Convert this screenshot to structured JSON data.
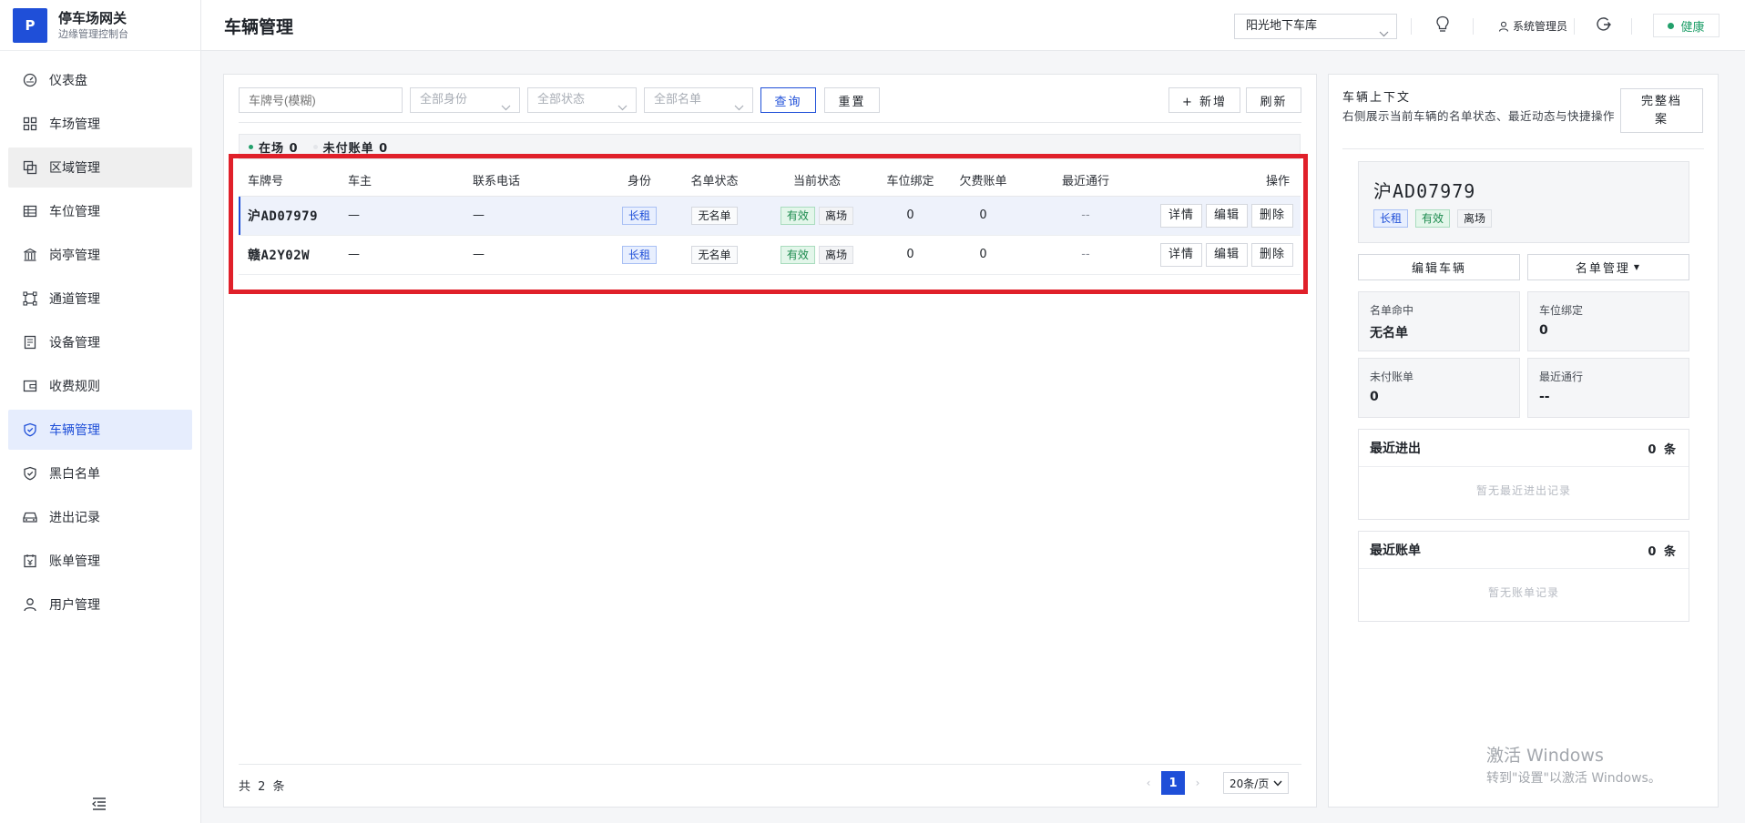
{
  "brand": {
    "logo": "P",
    "title": "停车场网关",
    "subtitle": "边缘管理控制台"
  },
  "sidebar": {
    "items": [
      {
        "label": "仪表盘",
        "icon": "dashboard-icon"
      },
      {
        "label": "车场管理",
        "icon": "grid-icon"
      },
      {
        "label": "区域管理",
        "icon": "layers-icon"
      },
      {
        "label": "车位管理",
        "icon": "table-icon"
      },
      {
        "label": "岗亭管理",
        "icon": "booth-icon"
      },
      {
        "label": "通道管理",
        "icon": "lane-icon"
      },
      {
        "label": "设备管理",
        "icon": "device-icon"
      },
      {
        "label": "收费规则",
        "icon": "wallet-icon"
      },
      {
        "label": "车辆管理",
        "icon": "shield-icon"
      },
      {
        "label": "黑白名单",
        "icon": "shield-check-icon"
      },
      {
        "label": "进出记录",
        "icon": "car-icon"
      },
      {
        "label": "账单管理",
        "icon": "bill-icon"
      },
      {
        "label": "用户管理",
        "icon": "user-icon"
      }
    ],
    "active_index": 8,
    "hovered_index": 2
  },
  "header": {
    "title": "车辆管理",
    "lot_select": "阳光地下车库",
    "user": "系统管理员",
    "health": "健康"
  },
  "filters": {
    "plate_placeholder": "车牌号(模糊)",
    "identity": "全部身份",
    "status": "全部状态",
    "list": "全部名单",
    "query": "查询",
    "reset": "重置",
    "add": "+ 新增",
    "refresh": "刷新"
  },
  "stats": {
    "in_lot": "在场 0",
    "unpaid": "未付账单 0"
  },
  "table": {
    "columns": [
      "车牌号",
      "车主",
      "联系电话",
      "身份",
      "名单状态",
      "当前状态",
      "车位绑定",
      "欠费账单",
      "最近通行",
      "操作"
    ],
    "rows": [
      {
        "plate": "沪AD07979",
        "owner": "—",
        "phone": "—",
        "identity": "长租",
        "list_status": "无名单",
        "valid": "有效",
        "presence": "离场",
        "bindings": "0",
        "arrears": "0",
        "last_pass": "--"
      },
      {
        "plate": "赣A2Y02W",
        "owner": "—",
        "phone": "—",
        "identity": "长租",
        "list_status": "无名单",
        "valid": "有效",
        "presence": "离场",
        "bindings": "0",
        "arrears": "0",
        "last_pass": "--"
      }
    ],
    "actions": {
      "detail": "详情",
      "edit": "编辑",
      "delete": "删除"
    }
  },
  "footer": {
    "total": "共 2 条",
    "page": "1",
    "page_size": "20条/页"
  },
  "context": {
    "title": "车辆上下文",
    "desc": "右侧展示当前车辆的名单状态、最近动态与快捷操作",
    "full_btn_line1": "完整档",
    "full_btn_line2": "案",
    "plate": "沪AD07979",
    "tags": [
      "长租",
      "有效",
      "离场"
    ],
    "edit_btn": "编辑车辆",
    "list_btn": "名单管理",
    "info": [
      {
        "label": "名单命中",
        "value": "无名单"
      },
      {
        "label": "车位绑定",
        "value": "0"
      },
      {
        "label": "未付账单",
        "value": "0"
      },
      {
        "label": "最近通行",
        "value": "--"
      }
    ],
    "recent_io": {
      "title": "最近进出",
      "count": "0 条",
      "empty": "暂无最近进出记录"
    },
    "recent_bills": {
      "title": "最近账单",
      "count": "0 条",
      "empty": "暂无账单记录"
    }
  },
  "watermark": {
    "line1": "激活 Windows",
    "line2": "转到\"设置\"以激活 Windows。"
  },
  "colors": {
    "accent": "#1f4fd8",
    "highlight_frame": "#e0202a",
    "health": "#22a06b"
  }
}
